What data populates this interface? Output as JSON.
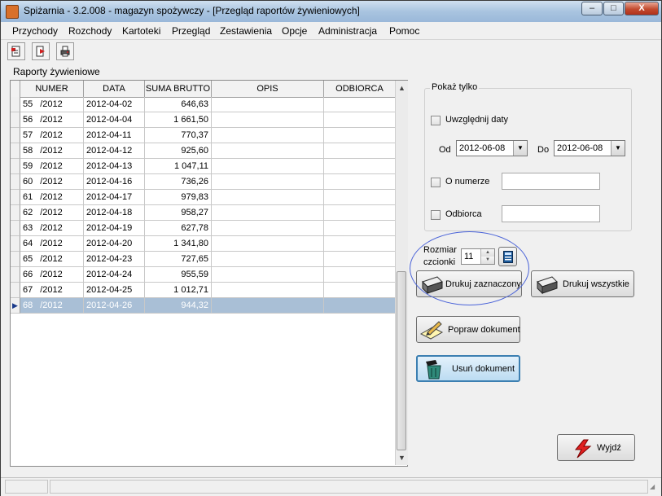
{
  "window": {
    "title": "Spiżarnia - 3.2.008 - magazyn spożywczy - [Przegląd raportów żywieniowych]",
    "controls": {
      "minimize": "–",
      "maximize": "□",
      "close": "X"
    }
  },
  "menu": [
    "Przychody",
    "Rozchody",
    "Kartoteki",
    "Przegląd",
    "Zestawienia",
    "Opcje",
    "Administracja",
    "Pomoc"
  ],
  "toolbar": {
    "icons": [
      "new-document-icon",
      "export-icon",
      "print-icon"
    ]
  },
  "reports": {
    "label": "Raporty żywieniowe",
    "columns": [
      "NUMER",
      "DATA",
      "SUMA BRUTTO",
      "OPIS",
      "ODBIORCA"
    ],
    "rows": [
      {
        "numer": "55",
        "suffix": "/2012",
        "data": "2012-04-02",
        "suma": "646,63",
        "opis": "",
        "odbiorca": ""
      },
      {
        "numer": "56",
        "suffix": "/2012",
        "data": "2012-04-04",
        "suma": "1 661,50",
        "opis": "",
        "odbiorca": ""
      },
      {
        "numer": "57",
        "suffix": "/2012",
        "data": "2012-04-11",
        "suma": "770,37",
        "opis": "",
        "odbiorca": ""
      },
      {
        "numer": "58",
        "suffix": "/2012",
        "data": "2012-04-12",
        "suma": "925,60",
        "opis": "",
        "odbiorca": ""
      },
      {
        "numer": "59",
        "suffix": "/2012",
        "data": "2012-04-13",
        "suma": "1 047,11",
        "opis": "",
        "odbiorca": ""
      },
      {
        "numer": "60",
        "suffix": "/2012",
        "data": "2012-04-16",
        "suma": "736,26",
        "opis": "",
        "odbiorca": ""
      },
      {
        "numer": "61",
        "suffix": "/2012",
        "data": "2012-04-17",
        "suma": "979,83",
        "opis": "",
        "odbiorca": ""
      },
      {
        "numer": "62",
        "suffix": "/2012",
        "data": "2012-04-18",
        "suma": "958,27",
        "opis": "",
        "odbiorca": ""
      },
      {
        "numer": "63",
        "suffix": "/2012",
        "data": "2012-04-19",
        "suma": "627,78",
        "opis": "",
        "odbiorca": ""
      },
      {
        "numer": "64",
        "suffix": "/2012",
        "data": "2012-04-20",
        "suma": "1 341,80",
        "opis": "",
        "odbiorca": ""
      },
      {
        "numer": "65",
        "suffix": "/2012",
        "data": "2012-04-23",
        "suma": "727,65",
        "opis": "",
        "odbiorca": ""
      },
      {
        "numer": "66",
        "suffix": "/2012",
        "data": "2012-04-24",
        "suma": "955,59",
        "opis": "",
        "odbiorca": ""
      },
      {
        "numer": "67",
        "suffix": "/2012",
        "data": "2012-04-25",
        "suma": "1 012,71",
        "opis": "",
        "odbiorca": ""
      },
      {
        "numer": "68",
        "suffix": "/2012",
        "data": "2012-04-26",
        "suma": "944,32",
        "opis": "",
        "odbiorca": ""
      }
    ],
    "selected_index": 13
  },
  "filters": {
    "group_title": "Pokaż tylko",
    "dates_label": "Uwzględnij daty",
    "from_label": "Od",
    "from_value": "2012-06-08",
    "to_label": "Do",
    "to_value": "2012-06-08",
    "number_label": "O numerze",
    "number_value": "",
    "recipient_label": "Odbiorca",
    "recipient_value": ""
  },
  "font": {
    "label_line1": "Rozmiar",
    "label_line2": "czcionki",
    "size": "11"
  },
  "buttons": {
    "print_selected": "Drukuj zaznaczony",
    "print_all": "Drukuj wszystkie",
    "edit": "Popraw dokument",
    "delete": "Usuń dokument",
    "exit": "Wyjdź"
  },
  "colors": {
    "selection": "#a9bfd6",
    "annotation_circle": "#4a63d8",
    "exit_icon": "#e02020"
  }
}
